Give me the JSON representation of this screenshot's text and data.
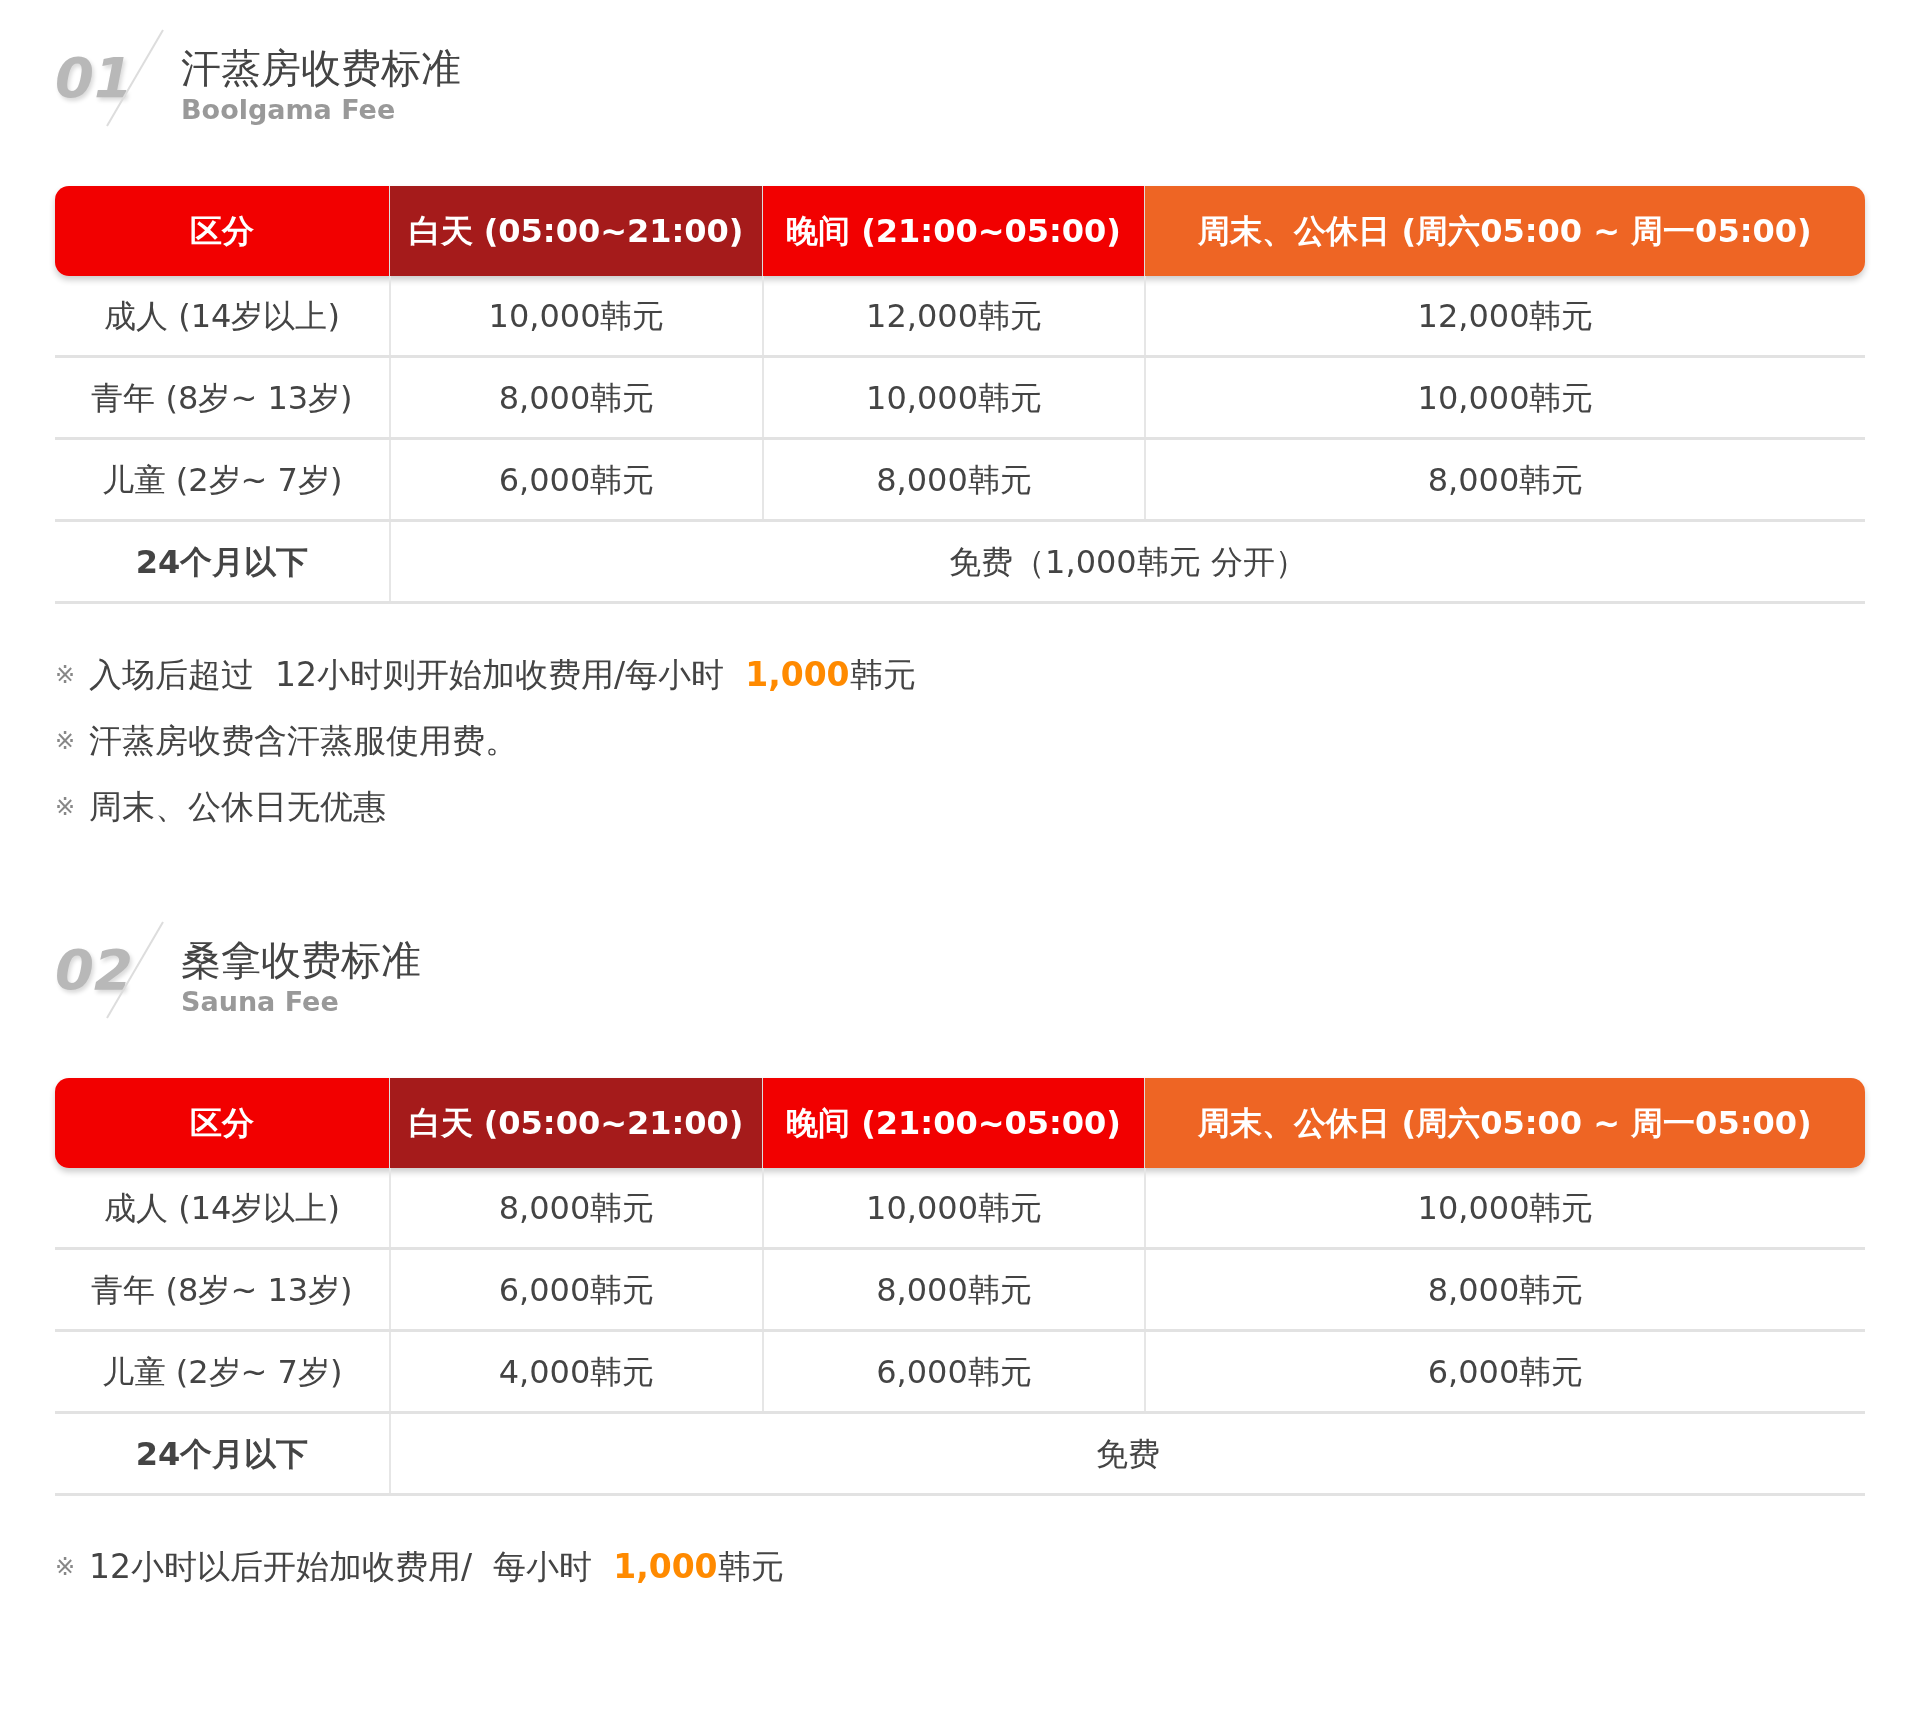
{
  "sections": [
    {
      "number": "01",
      "title": "汗蒸房收费标准",
      "subtitle": "Boolgama Fee",
      "columns": [
        {
          "label": "区分",
          "color": "#f20000"
        },
        {
          "label": "白天 (05:00~21:00)",
          "color": "#a51b1b"
        },
        {
          "label": "晚间 (21:00~05:00)",
          "color": "#f20000"
        },
        {
          "label": "周末、公休日 (周六05:00 ~ 周一05:00)",
          "color": "#ee6524"
        }
      ],
      "rows": [
        {
          "cells": [
            "成人 (14岁以上)",
            "10,000韩元",
            "12,000韩元",
            "12,000韩元"
          ]
        },
        {
          "cells": [
            "青年 (8岁~ 13岁)",
            "8,000韩元",
            "10,000韩元",
            "10,000韩元"
          ]
        },
        {
          "cells": [
            "儿童 (2岁~ 7岁)",
            "6,000韩元",
            "8,000韩元",
            "8,000韩元"
          ]
        },
        {
          "cells": [
            "24个月以下",
            "免费（1,000韩元  分开）"
          ]
        }
      ],
      "notes": [
        {
          "mark": "※",
          "parts": [
            {
              "text": "入场后超过  12小时则开始加收费用/每小时  ",
              "highlight": false
            },
            {
              "text": "1,000",
              "highlight": true
            },
            {
              "text": "韩元",
              "highlight": false
            }
          ]
        },
        {
          "mark": "※",
          "parts": [
            {
              "text": "汗蒸房收费含汗蒸服使用费。",
              "highlight": false
            }
          ]
        },
        {
          "mark": "※",
          "parts": [
            {
              "text": "周末、公休日无优惠",
              "highlight": false
            }
          ]
        }
      ]
    },
    {
      "number": "02",
      "title": "桑拿收费标准",
      "subtitle": "Sauna Fee",
      "columns": [
        {
          "label": "区分",
          "color": "#f20000"
        },
        {
          "label": "白天 (05:00~21:00)",
          "color": "#a51b1b"
        },
        {
          "label": "晚间 (21:00~05:00)",
          "color": "#f20000"
        },
        {
          "label": "周末、公休日 (周六05:00 ~ 周一05:00)",
          "color": "#ee6524"
        }
      ],
      "rows": [
        {
          "cells": [
            "成人 (14岁以上)",
            "8,000韩元",
            "10,000韩元",
            "10,000韩元"
          ]
        },
        {
          "cells": [
            "青年 (8岁~ 13岁)",
            "6,000韩元",
            "8,000韩元",
            "8,000韩元"
          ]
        },
        {
          "cells": [
            "儿童 (2岁~ 7岁)",
            "4,000韩元",
            "6,000韩元",
            "6,000韩元"
          ]
        },
        {
          "cells": [
            "24个月以下",
            "免费"
          ]
        }
      ],
      "notes": [
        {
          "mark": "※",
          "parts": [
            {
              "text": "12小时以后开始加收费用/  每小时  ",
              "highlight": false
            },
            {
              "text": "1,000",
              "highlight": true
            },
            {
              "text": "韩元",
              "highlight": false
            }
          ]
        }
      ]
    }
  ]
}
